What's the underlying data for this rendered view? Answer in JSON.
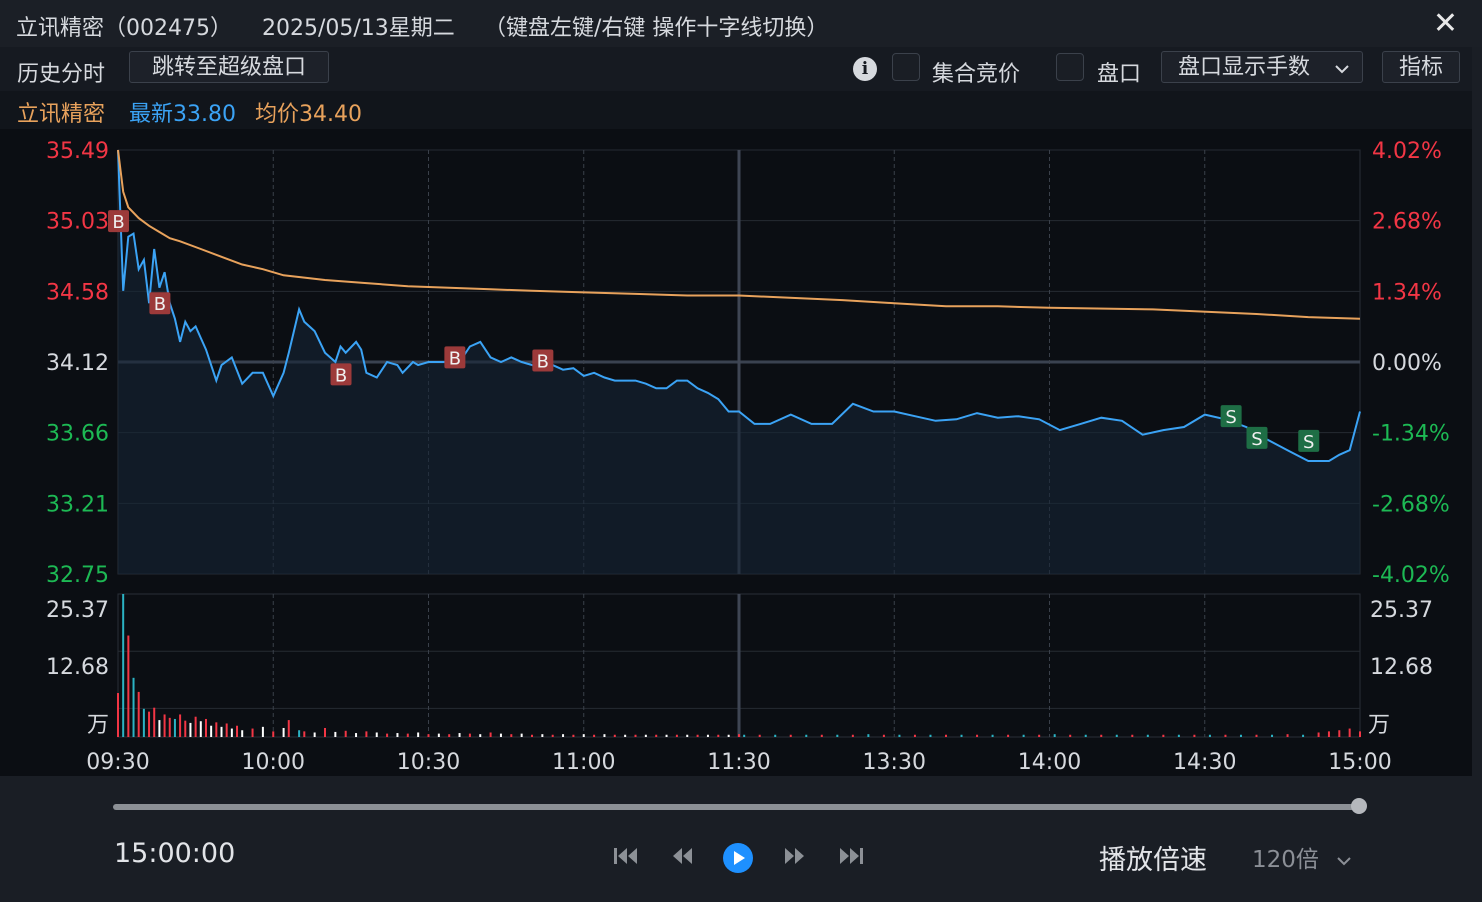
{
  "window": {
    "stock_name": "立讯精密",
    "stock_code": "（002475）",
    "date": "2025/05/13星期二",
    "hint": "（键盘左键/右键 操作十字线切换）",
    "close_glyph": "✕"
  },
  "toolbar": {
    "history_label": "历史分时",
    "jump_button": "跳转至超级盘口",
    "info_glyph": "i",
    "auction_label": "集合竞价",
    "pankou_label": "盘口",
    "pankou_select": "盘口显示手数",
    "indicator_button": "指标"
  },
  "legend": {
    "name": "立讯精密",
    "latest": "最新33.80",
    "avg": "均价34.40"
  },
  "colors": {
    "up": "#f23645",
    "down": "#1db954",
    "price_line": "#3ba3f5",
    "avg_line": "#e8a25c",
    "accent": "#1e90ff",
    "buy_marker": "#9c3a3a",
    "sell_marker": "#1e6e45"
  },
  "chart_data": {
    "type": "line",
    "price_ticks": [
      "35.49",
      "35.03",
      "34.58",
      "34.12",
      "33.66",
      "33.21",
      "32.75"
    ],
    "pct_ticks": [
      "4.02%",
      "2.68%",
      "1.34%",
      "0.00%",
      "-1.34%",
      "-2.68%",
      "-4.02%"
    ],
    "ylim": [
      32.75,
      35.49
    ],
    "prev_close": 34.12,
    "volume_ticks": [
      "25.37",
      "12.68"
    ],
    "volume_unit": "万",
    "volume_max": 25.37,
    "time_labels": [
      "09:30",
      "10:00",
      "10:30",
      "11:00",
      "11:30",
      "13:30",
      "14:00",
      "14:30",
      "15:00"
    ],
    "series": [
      {
        "name": "最新",
        "x": [
          0,
          1,
          2,
          3,
          4,
          5,
          6,
          7,
          8,
          9,
          10,
          11,
          12,
          13,
          14,
          15,
          17,
          19,
          20,
          22,
          24,
          26,
          28,
          30,
          32,
          33,
          35,
          36,
          38,
          40,
          42,
          43,
          44,
          46,
          47,
          48,
          50,
          52,
          54,
          55,
          57,
          58,
          60,
          62,
          64,
          66,
          68,
          70,
          72,
          74,
          76,
          78,
          80,
          82,
          84,
          86,
          88,
          90,
          92,
          94,
          96,
          98,
          100,
          102,
          104,
          106,
          108,
          110,
          112,
          114,
          116,
          118,
          120,
          123,
          126,
          130,
          134,
          138,
          142,
          146,
          150,
          154,
          158,
          162,
          166,
          170,
          174,
          178,
          182,
          186,
          190,
          194,
          198,
          202,
          206,
          210,
          214,
          218,
          222,
          226,
          230,
          234,
          236,
          238,
          240
        ],
        "y": [
          35.49,
          34.58,
          34.93,
          34.95,
          34.72,
          34.78,
          34.5,
          34.85,
          34.6,
          34.7,
          34.5,
          34.4,
          34.25,
          34.38,
          34.32,
          34.35,
          34.2,
          34.0,
          34.1,
          34.15,
          33.98,
          34.05,
          34.05,
          33.9,
          34.05,
          34.18,
          34.46,
          34.38,
          34.32,
          34.18,
          34.12,
          34.22,
          34.18,
          34.25,
          34.2,
          34.05,
          34.02,
          34.12,
          34.1,
          34.05,
          34.12,
          34.1,
          34.12,
          34.12,
          34.12,
          34.12,
          34.22,
          34.25,
          34.15,
          34.12,
          34.15,
          34.12,
          34.1,
          34.08,
          34.1,
          34.07,
          34.08,
          34.03,
          34.05,
          34.02,
          34.0,
          34.0,
          34.0,
          33.98,
          33.95,
          33.95,
          34.0,
          34.0,
          33.95,
          33.92,
          33.88,
          33.8,
          33.8,
          33.72,
          33.72,
          33.78,
          33.72,
          33.72,
          33.85,
          33.8,
          33.8,
          33.77,
          33.74,
          33.75,
          33.79,
          33.76,
          33.77,
          33.75,
          33.68,
          33.72,
          33.76,
          33.74,
          33.65,
          33.68,
          33.7,
          33.78,
          33.75,
          33.7,
          33.62,
          33.55,
          33.48,
          33.48,
          33.52,
          33.55,
          33.8
        ]
      },
      {
        "name": "均价",
        "x": [
          0,
          1,
          2,
          4,
          6,
          8,
          10,
          12,
          16,
          20,
          24,
          28,
          32,
          40,
          48,
          56,
          64,
          72,
          80,
          90,
          100,
          110,
          120,
          140,
          150,
          160,
          170,
          180,
          200,
          220,
          230,
          240
        ],
        "y": [
          35.49,
          35.22,
          35.12,
          35.05,
          35.0,
          34.96,
          34.92,
          34.9,
          34.85,
          34.8,
          34.75,
          34.72,
          34.68,
          34.65,
          34.63,
          34.61,
          34.6,
          34.59,
          34.58,
          34.57,
          34.56,
          34.55,
          34.55,
          34.52,
          34.5,
          34.48,
          34.48,
          34.47,
          34.46,
          34.43,
          34.41,
          34.4
        ]
      }
    ],
    "volume_series": [
      {
        "x": 0,
        "v": 7.8,
        "dir": "up"
      },
      {
        "x": 1,
        "v": 25.37,
        "dir": "down"
      },
      {
        "x": 2,
        "v": 18.0,
        "dir": "up"
      },
      {
        "x": 3,
        "v": 10.5,
        "dir": "down"
      },
      {
        "x": 4,
        "v": 8.0,
        "dir": "up"
      },
      {
        "x": 5,
        "v": 5.0,
        "dir": "down"
      },
      {
        "x": 6,
        "v": 4.5,
        "dir": "up"
      },
      {
        "x": 7,
        "v": 5.2,
        "dir": "up"
      },
      {
        "x": 8,
        "v": 3.0,
        "dir": "down"
      },
      {
        "x": 9,
        "v": 4.0,
        "dir": "up"
      },
      {
        "x": 10,
        "v": 3.4,
        "dir": "up"
      },
      {
        "x": 11,
        "v": 3.2,
        "dir": "down"
      },
      {
        "x": 12,
        "v": 4.0,
        "dir": "up"
      },
      {
        "x": 13,
        "v": 2.9,
        "dir": "up"
      },
      {
        "x": 14,
        "v": 2.5,
        "dir": "down"
      },
      {
        "x": 15,
        "v": 3.6,
        "dir": "up"
      },
      {
        "x": 16,
        "v": 2.8,
        "dir": "down"
      },
      {
        "x": 17,
        "v": 3.2,
        "dir": "up"
      },
      {
        "x": 18,
        "v": 2.0,
        "dir": "down"
      },
      {
        "x": 19,
        "v": 2.6,
        "dir": "up"
      },
      {
        "x": 20,
        "v": 1.8,
        "dir": "down"
      },
      {
        "x": 21,
        "v": 2.4,
        "dir": "up"
      },
      {
        "x": 22,
        "v": 1.5,
        "dir": "down"
      },
      {
        "x": 23,
        "v": 2.0,
        "dir": "up"
      },
      {
        "x": 24,
        "v": 1.2,
        "dir": "down"
      },
      {
        "x": 26,
        "v": 1.5,
        "dir": "up"
      },
      {
        "x": 28,
        "v": 1.8,
        "dir": "down"
      },
      {
        "x": 30,
        "v": 1.0,
        "dir": "up"
      },
      {
        "x": 32,
        "v": 1.6,
        "dir": "down"
      },
      {
        "x": 33,
        "v": 3.0,
        "dir": "up"
      },
      {
        "x": 35,
        "v": 1.2,
        "dir": "down"
      },
      {
        "x": 36,
        "v": 1.0,
        "dir": "up"
      },
      {
        "x": 38,
        "v": 0.8,
        "dir": "down"
      },
      {
        "x": 40,
        "v": 1.6,
        "dir": "up"
      },
      {
        "x": 42,
        "v": 0.9,
        "dir": "down"
      },
      {
        "x": 44,
        "v": 1.1,
        "dir": "up"
      },
      {
        "x": 46,
        "v": 0.7,
        "dir": "down"
      },
      {
        "x": 48,
        "v": 1.0,
        "dir": "up"
      },
      {
        "x": 50,
        "v": 0.8,
        "dir": "down"
      },
      {
        "x": 52,
        "v": 0.6,
        "dir": "up"
      },
      {
        "x": 54,
        "v": 0.7,
        "dir": "down"
      },
      {
        "x": 56,
        "v": 0.6,
        "dir": "up"
      },
      {
        "x": 58,
        "v": 0.8,
        "dir": "down"
      },
      {
        "x": 60,
        "v": 0.5,
        "dir": "up"
      },
      {
        "x": 62,
        "v": 0.6,
        "dir": "down"
      },
      {
        "x": 64,
        "v": 0.5,
        "dir": "up"
      },
      {
        "x": 66,
        "v": 0.7,
        "dir": "down"
      },
      {
        "x": 68,
        "v": 0.6,
        "dir": "up"
      },
      {
        "x": 70,
        "v": 0.5,
        "dir": "down"
      },
      {
        "x": 72,
        "v": 0.8,
        "dir": "up"
      },
      {
        "x": 74,
        "v": 0.6,
        "dir": "down"
      },
      {
        "x": 76,
        "v": 0.5,
        "dir": "up"
      },
      {
        "x": 78,
        "v": 0.6,
        "dir": "down"
      },
      {
        "x": 80,
        "v": 0.4,
        "dir": "up"
      },
      {
        "x": 82,
        "v": 0.5,
        "dir": "down"
      },
      {
        "x": 84,
        "v": 0.4,
        "dir": "up"
      },
      {
        "x": 86,
        "v": 0.5,
        "dir": "down"
      },
      {
        "x": 88,
        "v": 0.4,
        "dir": "up"
      },
      {
        "x": 90,
        "v": 0.5,
        "dir": "down"
      },
      {
        "x": 92,
        "v": 0.4,
        "dir": "up"
      },
      {
        "x": 94,
        "v": 0.5,
        "dir": "down"
      },
      {
        "x": 96,
        "v": 0.4,
        "dir": "up"
      },
      {
        "x": 98,
        "v": 0.4,
        "dir": "down"
      },
      {
        "x": 100,
        "v": 0.4,
        "dir": "up"
      },
      {
        "x": 102,
        "v": 0.4,
        "dir": "down"
      },
      {
        "x": 104,
        "v": 0.4,
        "dir": "up"
      },
      {
        "x": 106,
        "v": 0.4,
        "dir": "down"
      },
      {
        "x": 108,
        "v": 0.4,
        "dir": "up"
      },
      {
        "x": 110,
        "v": 0.4,
        "dir": "down"
      },
      {
        "x": 112,
        "v": 0.4,
        "dir": "up"
      },
      {
        "x": 114,
        "v": 0.4,
        "dir": "down"
      },
      {
        "x": 116,
        "v": 0.4,
        "dir": "up"
      },
      {
        "x": 118,
        "v": 0.4,
        "dir": "down"
      },
      {
        "x": 120,
        "v": 0.5,
        "dir": "up"
      },
      {
        "x": 121,
        "v": 0.4,
        "dir": "down"
      },
      {
        "x": 124,
        "v": 0.4,
        "dir": "up"
      },
      {
        "x": 127,
        "v": 0.4,
        "dir": "down"
      },
      {
        "x": 130,
        "v": 0.4,
        "dir": "up"
      },
      {
        "x": 133,
        "v": 0.4,
        "dir": "down"
      },
      {
        "x": 136,
        "v": 0.4,
        "dir": "up"
      },
      {
        "x": 139,
        "v": 0.4,
        "dir": "down"
      },
      {
        "x": 142,
        "v": 0.4,
        "dir": "up"
      },
      {
        "x": 145,
        "v": 0.5,
        "dir": "down"
      },
      {
        "x": 148,
        "v": 0.4,
        "dir": "up"
      },
      {
        "x": 151,
        "v": 0.4,
        "dir": "down"
      },
      {
        "x": 154,
        "v": 0.4,
        "dir": "up"
      },
      {
        "x": 157,
        "v": 0.4,
        "dir": "down"
      },
      {
        "x": 160,
        "v": 0.4,
        "dir": "up"
      },
      {
        "x": 163,
        "v": 0.4,
        "dir": "down"
      },
      {
        "x": 166,
        "v": 0.4,
        "dir": "up"
      },
      {
        "x": 169,
        "v": 0.4,
        "dir": "down"
      },
      {
        "x": 172,
        "v": 0.4,
        "dir": "up"
      },
      {
        "x": 175,
        "v": 0.4,
        "dir": "down"
      },
      {
        "x": 178,
        "v": 0.4,
        "dir": "up"
      },
      {
        "x": 181,
        "v": 0.5,
        "dir": "down"
      },
      {
        "x": 184,
        "v": 0.4,
        "dir": "up"
      },
      {
        "x": 187,
        "v": 0.4,
        "dir": "down"
      },
      {
        "x": 190,
        "v": 0.4,
        "dir": "up"
      },
      {
        "x": 193,
        "v": 0.4,
        "dir": "down"
      },
      {
        "x": 196,
        "v": 0.4,
        "dir": "up"
      },
      {
        "x": 199,
        "v": 0.4,
        "dir": "down"
      },
      {
        "x": 202,
        "v": 0.4,
        "dir": "up"
      },
      {
        "x": 205,
        "v": 0.4,
        "dir": "down"
      },
      {
        "x": 208,
        "v": 0.4,
        "dir": "up"
      },
      {
        "x": 211,
        "v": 0.4,
        "dir": "down"
      },
      {
        "x": 214,
        "v": 0.4,
        "dir": "up"
      },
      {
        "x": 217,
        "v": 0.4,
        "dir": "down"
      },
      {
        "x": 220,
        "v": 0.4,
        "dir": "up"
      },
      {
        "x": 223,
        "v": 0.4,
        "dir": "down"
      },
      {
        "x": 226,
        "v": 0.5,
        "dir": "up"
      },
      {
        "x": 229,
        "v": 0.4,
        "dir": "down"
      },
      {
        "x": 232,
        "v": 0.8,
        "dir": "up"
      },
      {
        "x": 234,
        "v": 1.0,
        "dir": "up"
      },
      {
        "x": 236,
        "v": 1.2,
        "dir": "up"
      },
      {
        "x": 238,
        "v": 1.5,
        "dir": "up"
      },
      {
        "x": 240,
        "v": 1.0,
        "dir": "up"
      }
    ],
    "markers": [
      {
        "label": "B",
        "x": 0,
        "y": 35.03
      },
      {
        "label": "B",
        "x": 8,
        "y": 34.5
      },
      {
        "label": "B",
        "x": 43,
        "y": 34.04
      },
      {
        "label": "B",
        "x": 65,
        "y": 34.15
      },
      {
        "label": "B",
        "x": 82,
        "y": 34.13
      },
      {
        "label": "S",
        "x": 215,
        "y": 33.77
      },
      {
        "label": "S",
        "x": 220,
        "y": 33.63
      },
      {
        "label": "S",
        "x": 230,
        "y": 33.61
      }
    ]
  },
  "playback": {
    "current_time": "15:00:00",
    "progress": 1.0,
    "speed_label": "播放倍速",
    "speed_value": "120倍"
  }
}
